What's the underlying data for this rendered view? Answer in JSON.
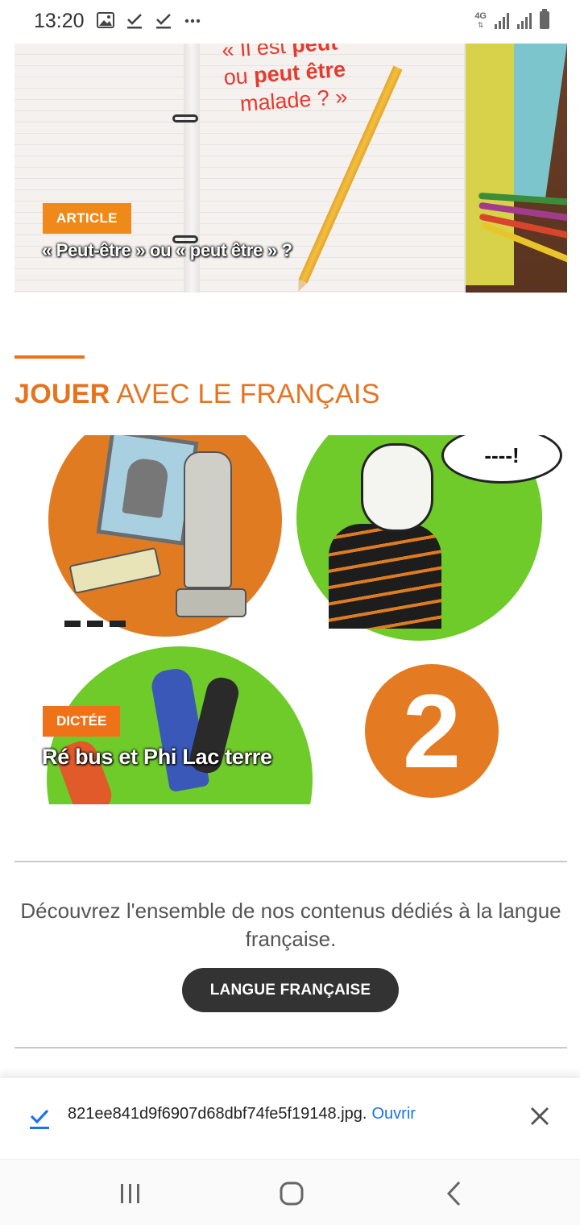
{
  "status_bar": {
    "time": "13:20",
    "network": "4G",
    "icons_left": [
      "image-icon",
      "check-icon",
      "check-icon",
      "more-dots-icon"
    ],
    "icons_right": [
      "signal-icon",
      "signal-icon",
      "battery-icon"
    ]
  },
  "article_card": {
    "image_quote_line1": "« Il est ",
    "image_quote_bold1": "peut",
    "image_quote_line2": "ou ",
    "image_quote_bold2": "peut être",
    "image_quote_line3": "malade ? »",
    "tag": "ARTICLE",
    "title": "« Peut-être » ou « peut être » ?"
  },
  "section": {
    "title_bold": "JOUER",
    "title_rest": " AVEC LE FRANÇAIS",
    "accent_color": "#e8731f"
  },
  "game_card": {
    "tag": "DICTÉE",
    "title": "Ré bus et Phi Lac terre",
    "speech_bubble": "----!",
    "number": "2"
  },
  "discover": {
    "text": "Découvrez l'ensemble de nos contenus dédiés à la langue française.",
    "button_label": "LANGUE FRANÇAISE"
  },
  "download_bar": {
    "filename": "821ee841d9f6907d68dbf74fe5f19148.jpg.",
    "open_label": "Ouvrir",
    "link_color": "#1a73e8"
  },
  "nav_bar": {
    "items": [
      "recent-apps-icon",
      "home-icon",
      "back-icon"
    ]
  }
}
